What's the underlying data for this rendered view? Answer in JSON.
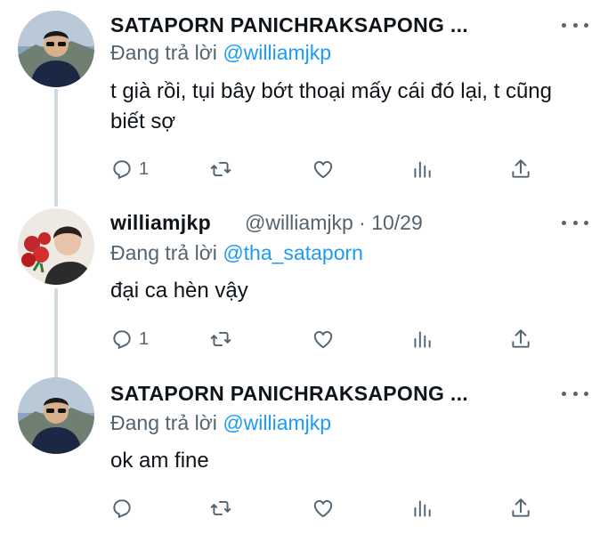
{
  "tweets": [
    {
      "display_name": "SATAPORN PANICHRAKSAPONG ...",
      "handle": "",
      "date": "",
      "reply_prefix": "Đang trả lời",
      "reply_to": "@williamjkp",
      "text": "t già rồi, tụi bây bớt thoại mấy cái đó lại, t cũng biết sợ",
      "reply_count": "1"
    },
    {
      "display_name": "williamjkp",
      "handle": "@williamjkp",
      "date": "· 10/29",
      "reply_prefix": "Đang trả lời",
      "reply_to": "@tha_sataporn",
      "text": "đại ca hèn vậy",
      "reply_count": "1"
    },
    {
      "display_name": "SATAPORN PANICHRAKSAPONG ...",
      "handle": "",
      "date": "",
      "reply_prefix": "Đang trả lời",
      "reply_to": "@williamjkp",
      "text": "ok am fine",
      "reply_count": ""
    }
  ],
  "icons": {
    "reply": "reply-icon",
    "retweet": "retweet-icon",
    "like": "heart-icon",
    "views": "analytics-icon",
    "share": "share-icon",
    "more": "more-icon"
  },
  "colors": {
    "text": "#0f1419",
    "secondary": "#536471",
    "accent": "#1d9bf0",
    "thread_line": "#cfd9de"
  }
}
